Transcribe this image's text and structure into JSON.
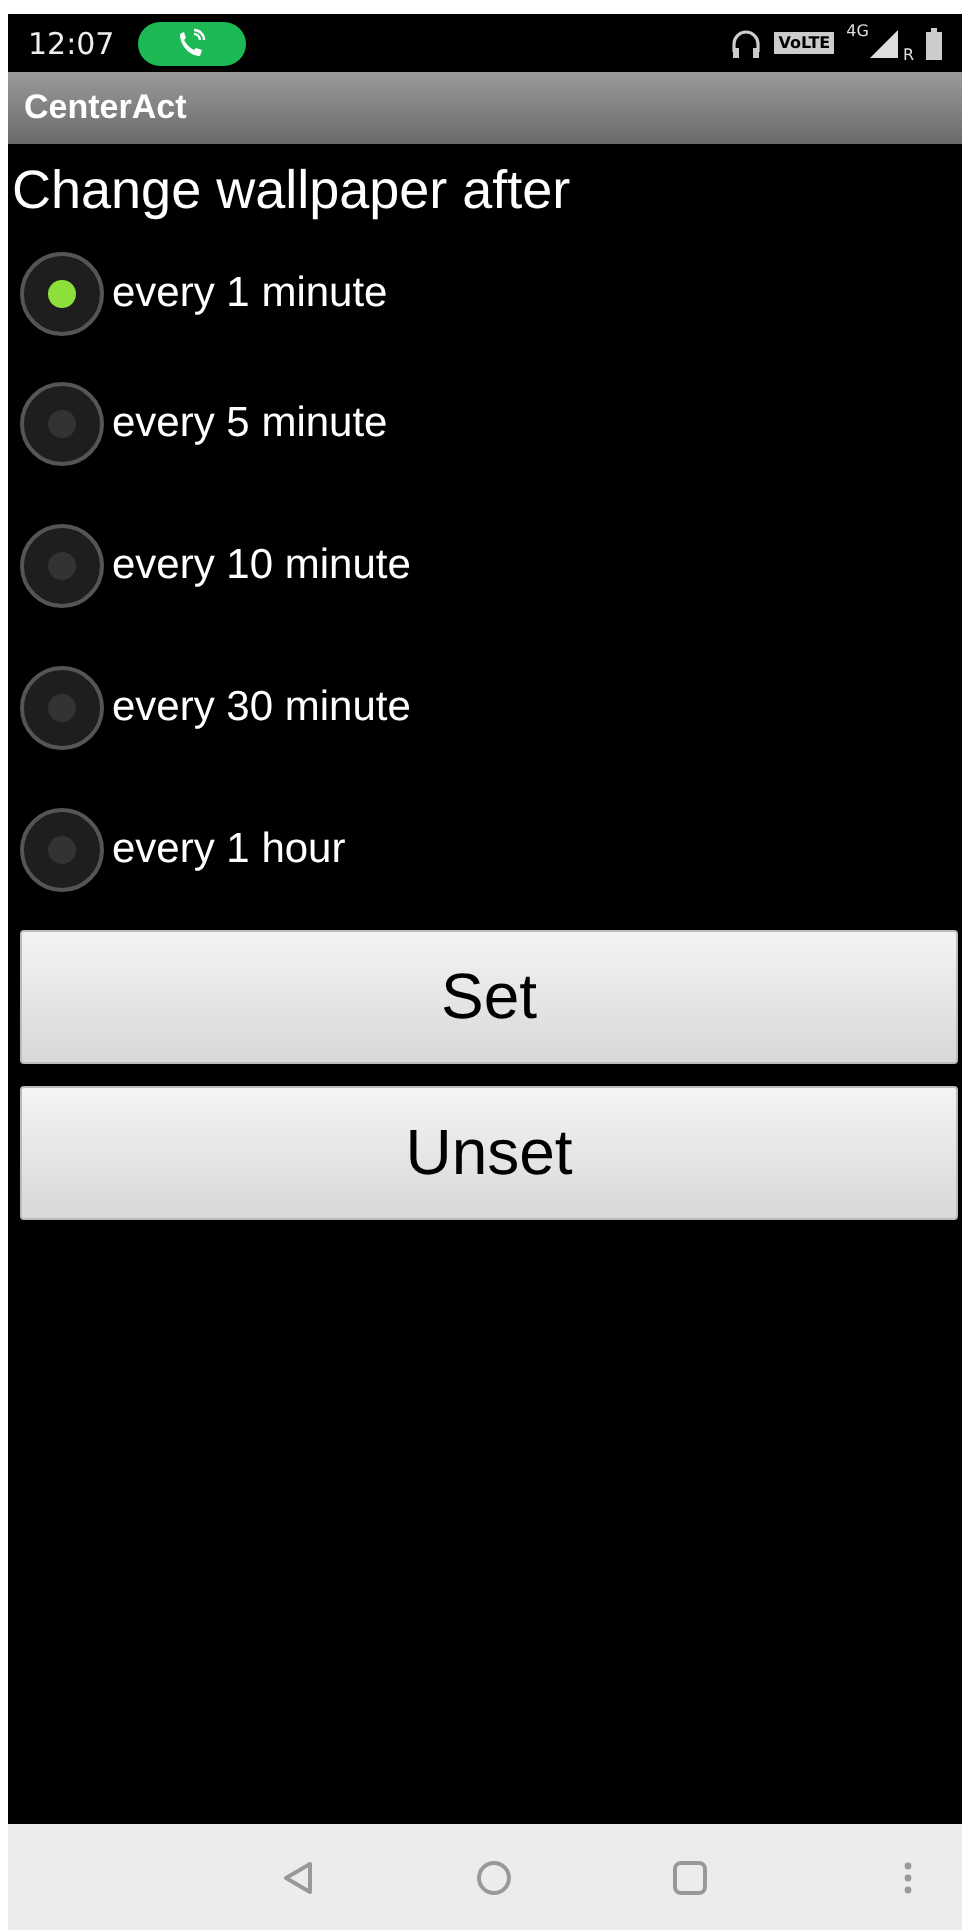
{
  "status_bar": {
    "time": "12:07",
    "volte": "VoLTE",
    "network": "4G",
    "roaming": "R"
  },
  "title_bar": {
    "title": "CenterAct"
  },
  "heading": "Change wallpaper after",
  "options": [
    {
      "label": "every 1 minute",
      "selected": true
    },
    {
      "label": "every 5 minute",
      "selected": false
    },
    {
      "label": "every 10 minute",
      "selected": false
    },
    {
      "label": "every 30 minute",
      "selected": false
    },
    {
      "label": "every 1 hour",
      "selected": false
    }
  ],
  "buttons": [
    "Set",
    "Unset"
  ]
}
